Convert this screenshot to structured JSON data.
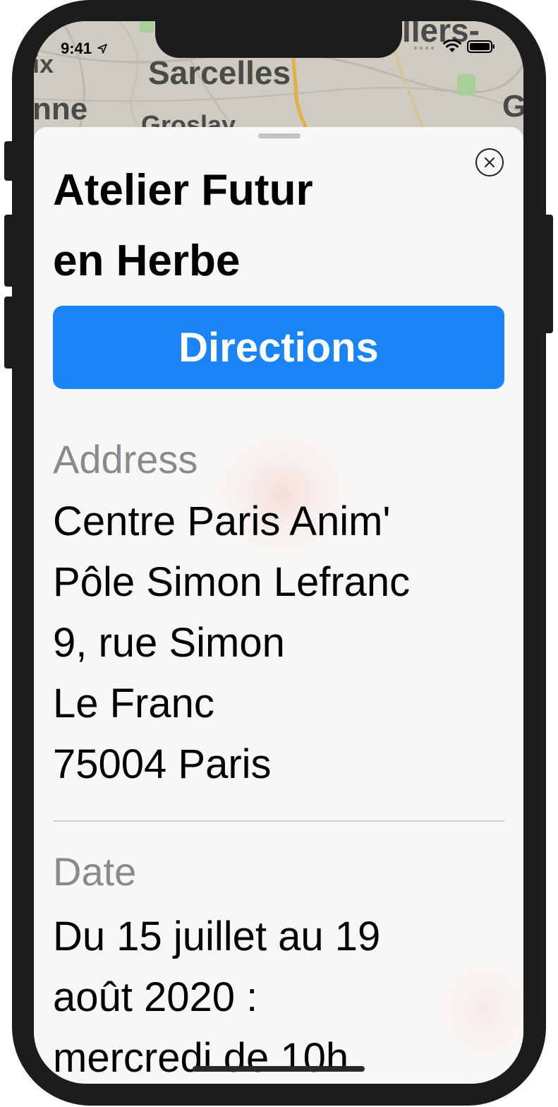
{
  "status_bar": {
    "time": "9:41"
  },
  "map": {
    "labels": [
      "Sarcelles",
      "Groslay",
      "ix",
      "nne",
      "llers-",
      "G"
    ]
  },
  "sheet": {
    "title_line1": "Atelier Futur",
    "title_line2": "en Herbe",
    "directions_label": "Directions",
    "address": {
      "label": "Address",
      "lines": [
        "Centre Paris Anim'",
        "Pôle Simon Lefranc",
        "9, rue Simon",
        "Le Franc",
        "75004 Paris"
      ]
    },
    "date": {
      "label": "Date",
      "lines": [
        "Du 15 juillet au 19",
        "août 2020 :",
        "mercredi de 10h"
      ]
    }
  },
  "colors": {
    "accent": "#1a84f5",
    "secondary_text": "#8a8a8e",
    "device_frame": "#1c1c1c"
  }
}
